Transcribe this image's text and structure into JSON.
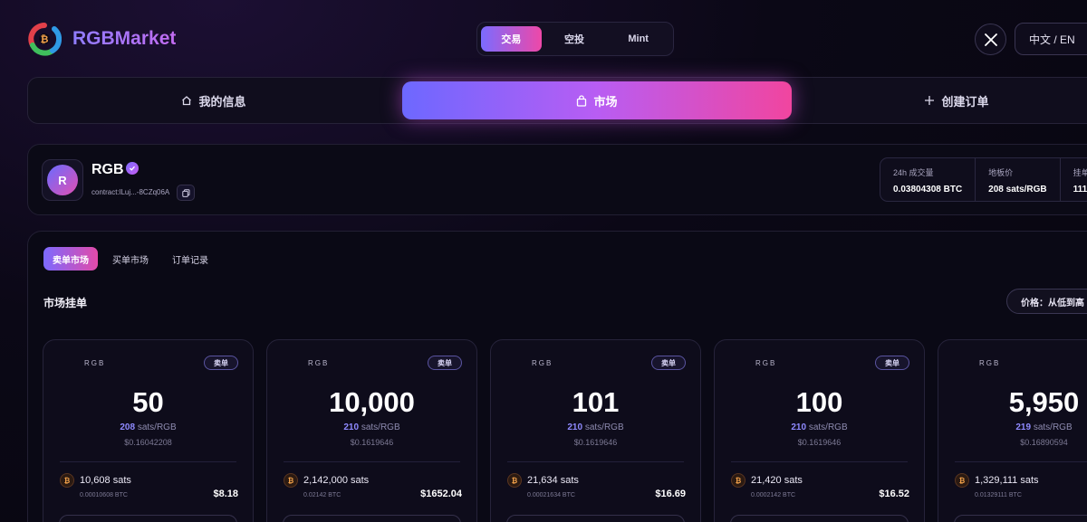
{
  "header": {
    "brand": "RGBMarket",
    "segments": [
      {
        "label": "交易",
        "active": true
      },
      {
        "label": "空投",
        "active": false
      },
      {
        "label": "Mint",
        "active": false
      }
    ],
    "x_icon": "x-logo-icon",
    "lang": "中文 / EN"
  },
  "nav": [
    {
      "label": "我的信息",
      "icon": "home-icon",
      "active": false
    },
    {
      "label": "市场",
      "icon": "bag-icon",
      "active": true
    },
    {
      "label": "创建订单",
      "icon": "plus-icon",
      "active": false
    }
  ],
  "token": {
    "avatar_letter": "R",
    "name": "RGB",
    "contract": "contract:lLuj...-8CZq06A",
    "stats": [
      {
        "label": "24h 成交量",
        "value": "0.03804308 BTC"
      },
      {
        "label": "地板价",
        "value": "208 sats/RGB"
      },
      {
        "label": "挂单",
        "value": "111"
      }
    ]
  },
  "market": {
    "tabs": [
      {
        "label": "卖单市场",
        "active": true
      },
      {
        "label": "买单市场",
        "active": false
      },
      {
        "label": "订单记录",
        "active": false
      }
    ],
    "section_title": "市场挂单",
    "sort_label": "价格：从低到高",
    "cards": [
      {
        "ticker": "RGB",
        "badge": "卖单",
        "amount": "50",
        "price": "208",
        "unit": " sats/RGB",
        "unit_usd": "$0.16042208",
        "btc_symbol": "₿",
        "total_sats": "10,608 sats",
        "total_btc": "0.00010608 BTC",
        "usd": "$8.18"
      },
      {
        "ticker": "RGB",
        "badge": "卖单",
        "amount": "10,000",
        "price": "210",
        "unit": " sats/RGB",
        "unit_usd": "$0.1619646",
        "btc_symbol": "₿",
        "total_sats": "2,142,000 sats",
        "total_btc": "0.02142 BTC",
        "usd": "$1652.04"
      },
      {
        "ticker": "RGB",
        "badge": "卖单",
        "amount": "101",
        "price": "210",
        "unit": " sats/RGB",
        "unit_usd": "$0.1619646",
        "btc_symbol": "₿",
        "total_sats": "21,634 sats",
        "total_btc": "0.00021634 BTC",
        "usd": "$16.69"
      },
      {
        "ticker": "RGB",
        "badge": "卖单",
        "amount": "100",
        "price": "210",
        "unit": " sats/RGB",
        "unit_usd": "$0.1619646",
        "btc_symbol": "₿",
        "total_sats": "21,420 sats",
        "total_btc": "0.0002142 BTC",
        "usd": "$16.52"
      },
      {
        "ticker": "RGB",
        "badge": "",
        "amount": "5,950",
        "price": "219",
        "unit": " sats/RGB",
        "unit_usd": "$0.16890594",
        "btc_symbol": "₿",
        "total_sats": "1,329,111 sats",
        "total_btc": "0.01329111 BTC",
        "usd": ""
      }
    ]
  },
  "colors": {
    "accent_start": "#6d68ff",
    "accent_end": "#f1459f",
    "background": "#07060f",
    "price_highlight": "#8f8aff",
    "btc_orange": "#f2a14a"
  }
}
